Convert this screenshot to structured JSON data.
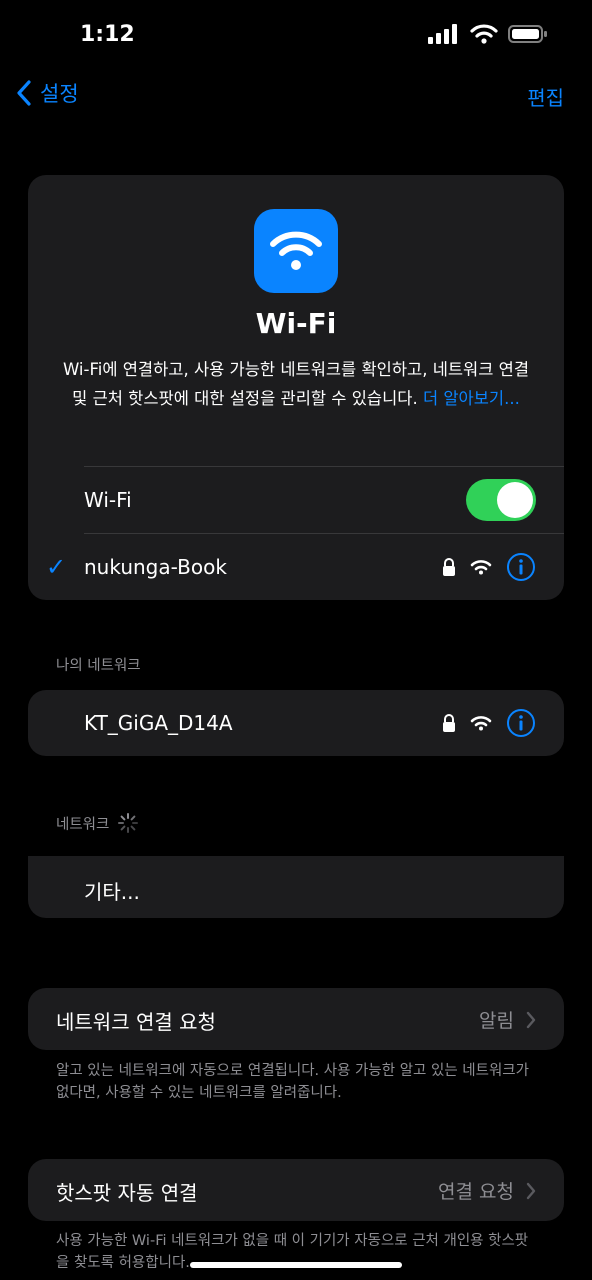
{
  "status_bar": {
    "time": "1:12"
  },
  "nav": {
    "back_label": "설정",
    "edit_label": "편집"
  },
  "hero": {
    "title": "Wi-Fi",
    "description": "Wi-Fi에 연결하고, 사용 가능한 네트워크를 확인하고, 네트워크 연결 및 근처 핫스팟에 대한 설정을 관리할 수 있습니다.",
    "learn_more": "더 알아보기..."
  },
  "wifi_toggle": {
    "label": "Wi-Fi",
    "on": true
  },
  "connected_network": {
    "name": "nukunga-Book"
  },
  "my_networks": {
    "header": "나의 네트워크",
    "items": [
      {
        "name": "KT_GiGA_D14A"
      }
    ]
  },
  "networks": {
    "header": "네트워크",
    "other_label": "기타..."
  },
  "ask_to_join": {
    "label": "네트워크 연결 요청",
    "value": "알림",
    "footer": "알고 있는 네트워크에 자동으로 연결됩니다. 사용 가능한 알고 있는 네트워크가 없다면, 사용할 수 있는 네트워크를 알려줍니다."
  },
  "auto_join_hotspot": {
    "label": "핫스팟 자동 연결",
    "value": "연결 요청",
    "footer": "사용 가능한 Wi-Fi 네트워크가 없을 때 이 기기가 자동으로 근처 개인용 핫스팟을 찾도록 허용합니다."
  },
  "colors": {
    "accent": "#0a84ff",
    "toggle_on": "#30d158",
    "card": "#1c1c1e",
    "secondary_text": "#8e8e93"
  }
}
